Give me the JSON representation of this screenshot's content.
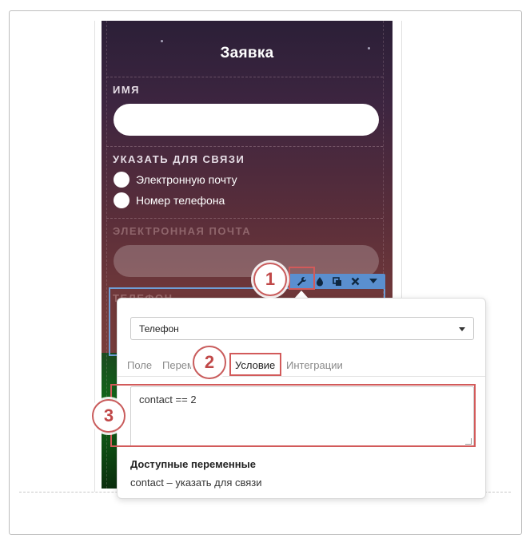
{
  "form": {
    "title": "Заявка",
    "name_label": "ИМЯ",
    "contact_label": "УКАЗАТЬ ДЛЯ СВЯЗИ",
    "contact_options": [
      "Электронную почту",
      "Номер телефона"
    ],
    "email_label": "ЭЛЕКТРОННАЯ ПОЧТА",
    "phone_label": "ТЕЛЕФОН"
  },
  "toolbar": {
    "icons": [
      "wrench-icon",
      "drop-icon",
      "copy-icon",
      "close-icon",
      "caret-down-icon"
    ]
  },
  "callouts": [
    "1",
    "2",
    "3"
  ],
  "panel": {
    "selected_field": "Телефон",
    "tabs": [
      "Поле",
      "Перем",
      "Условие",
      "Интеграции"
    ],
    "active_tab": "Условие",
    "condition_value": "contact == 2",
    "vars_title": "Доступные переменные",
    "vars_line": "contact – указать для связи"
  },
  "colors": {
    "highlight": "#d25a5a",
    "toolbar": "#5a8fcf",
    "selection_outline": "#6f9ed6"
  }
}
